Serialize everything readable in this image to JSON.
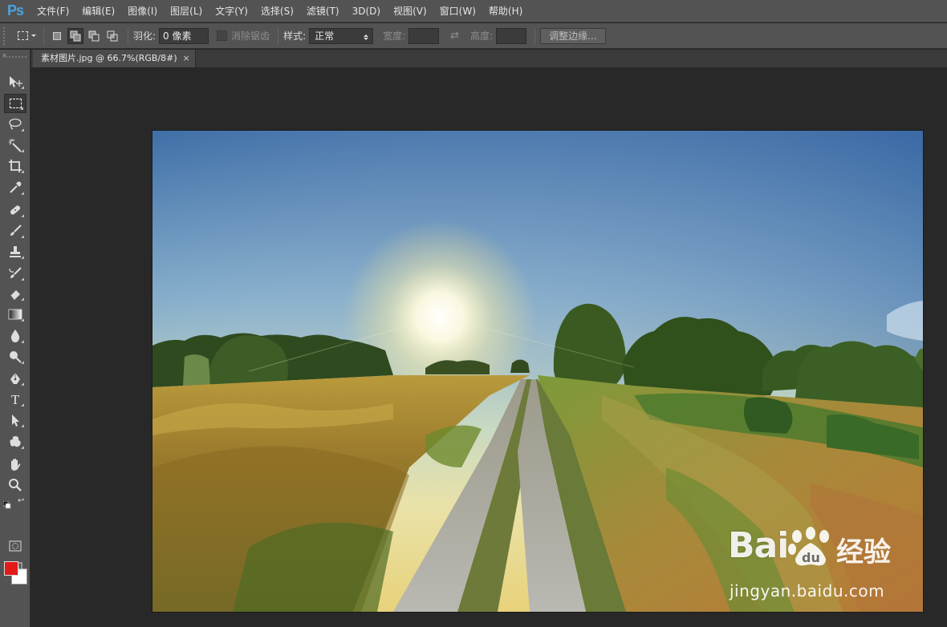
{
  "app": {
    "logo": "Ps",
    "menu": [
      "文件(F)",
      "编辑(E)",
      "图像(I)",
      "图层(L)",
      "文字(Y)",
      "选择(S)",
      "滤镜(T)",
      "3D(D)",
      "视图(V)",
      "窗口(W)",
      "帮助(H)"
    ]
  },
  "options": {
    "feather_label": "羽化:",
    "feather_value": "0 像素",
    "antialias_label": "消除锯齿",
    "style_label": "样式:",
    "style_value": "正常",
    "width_label": "宽度:",
    "height_label": "高度:",
    "refine_edge_label": "调整边缘..."
  },
  "document": {
    "tab_title": "素材图片.jpg @ 66.7%(RGB/8#)",
    "close_glyph": "×"
  },
  "colors": {
    "foreground": "#e31a1a",
    "background": "#ffffff",
    "ui_panel": "#535353",
    "workspace": "#282828"
  },
  "watermark": {
    "logo_text": "Bai",
    "logo_text2": "du",
    "brand": "经验",
    "url": "jingyan.baidu.com"
  },
  "tools": [
    "move-tool",
    "rectangular-marquee-tool",
    "lasso-tool",
    "magic-wand-tool",
    "crop-tool",
    "eyedropper-tool",
    "healing-brush-tool",
    "brush-tool",
    "clone-stamp-tool",
    "history-brush-tool",
    "eraser-tool",
    "gradient-tool",
    "blur-tool",
    "dodge-tool",
    "pen-tool",
    "type-tool",
    "path-selection-tool",
    "custom-shape-tool",
    "hand-tool",
    "zoom-tool"
  ]
}
